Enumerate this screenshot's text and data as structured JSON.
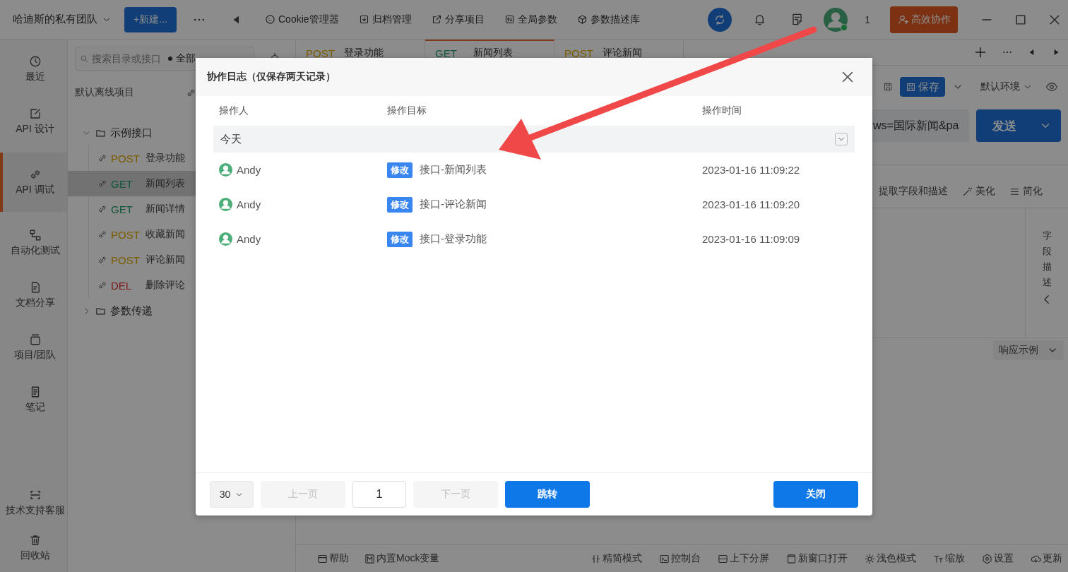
{
  "topbar": {
    "team": "哈迪斯的私有团队",
    "new_button": "+新建...",
    "tools": [
      {
        "kind": "cookie",
        "label": "Cookie管理器"
      },
      {
        "kind": "archive",
        "label": "归档管理"
      },
      {
        "kind": "share",
        "label": "分享项目"
      },
      {
        "kind": "sliders",
        "label": "全局参数"
      },
      {
        "kind": "cube",
        "label": "参数描述库"
      }
    ],
    "online_count": "1",
    "collab_button": "高效协作"
  },
  "rail": {
    "items": [
      {
        "kind": "clock",
        "label": "最近",
        "selected": false
      },
      {
        "kind": "edit",
        "label": "API 设计",
        "selected": false
      },
      {
        "kind": "link",
        "label": "API 调试",
        "selected": true
      },
      {
        "kind": "flow",
        "label": "自动化测试",
        "selected": false
      },
      {
        "kind": "doc",
        "label": "文档分享",
        "selected": false
      },
      {
        "kind": "layers",
        "label": "项目/团队",
        "selected": false
      },
      {
        "kind": "note",
        "label": "笔记",
        "selected": false
      }
    ],
    "bottom_items": [
      {
        "kind": "support",
        "label": "技术支持客服"
      },
      {
        "kind": "trash",
        "label": "回收站"
      }
    ]
  },
  "tree": {
    "search": {
      "placeholder": "搜索目录或接口"
    },
    "filter": "全部",
    "project": "默认离线项目",
    "folders": [
      {
        "name": "示例接口",
        "expanded": true,
        "children": [
          {
            "method": "POST",
            "kind": "post",
            "name": "登录功能",
            "selected": false
          },
          {
            "method": "GET",
            "kind": "get",
            "name": "新闻列表",
            "selected": true
          },
          {
            "method": "GET",
            "kind": "get",
            "name": "新闻详情",
            "selected": false
          },
          {
            "method": "POST",
            "kind": "post",
            "name": "收藏新闻",
            "selected": false
          },
          {
            "method": "POST",
            "kind": "post",
            "name": "评论新闻",
            "selected": false
          },
          {
            "method": "DEL",
            "kind": "delete",
            "name": "删除评论",
            "selected": false
          }
        ]
      },
      {
        "name": "参数传递",
        "expanded": false
      }
    ]
  },
  "tabs": [
    {
      "method": "POST",
      "kind": "post",
      "name": "登录功能",
      "selected": false
    },
    {
      "method": "GET",
      "kind": "get",
      "name": "新闻列表",
      "selected": true
    },
    {
      "method": "POST",
      "kind": "post",
      "name": "评论新闻",
      "selected": false
    }
  ],
  "request": {
    "save_button": "保存",
    "environment": "默认环境",
    "url": "ws=国际新闻&pa",
    "send_button": "发送"
  },
  "body_tools": [
    {
      "kind": "none",
      "label": "提取字段和描述"
    },
    {
      "kind": "wand",
      "label": "美化"
    },
    {
      "kind": "lines",
      "label": "简化"
    }
  ],
  "side_panel": "字段描述",
  "response_select": "响应示例",
  "status_bar": {
    "left": [
      {
        "kind": "help",
        "label": "帮助"
      },
      {
        "kind": "mock",
        "label": "内置Mock变量"
      }
    ],
    "right": [
      {
        "kind": "compact",
        "label": "精简模式"
      },
      {
        "kind": "console",
        "label": "控制台"
      },
      {
        "kind": "splitv",
        "label": "上下分屏"
      },
      {
        "kind": "window",
        "label": "新窗口打开"
      },
      {
        "kind": "sun",
        "label": "浅色模式"
      },
      {
        "kind": "font",
        "label": "缩放"
      },
      {
        "kind": "gear",
        "label": "设置"
      },
      {
        "kind": "download",
        "label": "更新"
      }
    ]
  },
  "dialog": {
    "title": "协作日志（仅保存两天记录）",
    "columns": [
      "操作人",
      "操作目标",
      "操作时间"
    ],
    "groups": [
      {
        "label": "今天",
        "expanded": true,
        "rows": [
          {
            "user": "Andy",
            "action": "修改",
            "target": "接口-新闻列表",
            "time": "2023-01-16 11:09:22"
          },
          {
            "user": "Andy",
            "action": "修改",
            "target": "接口-评论新闻",
            "time": "2023-01-16 11:09:20"
          },
          {
            "user": "Andy",
            "action": "修改",
            "target": "接口-登录功能",
            "time": "2023-01-16 11:09:09"
          }
        ]
      }
    ],
    "pagination": {
      "page_size": "30",
      "prev": "上一页",
      "prev_disabled": true,
      "page": "1",
      "next": "下一页",
      "next_disabled": true,
      "jump": "跳转"
    },
    "close_button": "关闭"
  }
}
